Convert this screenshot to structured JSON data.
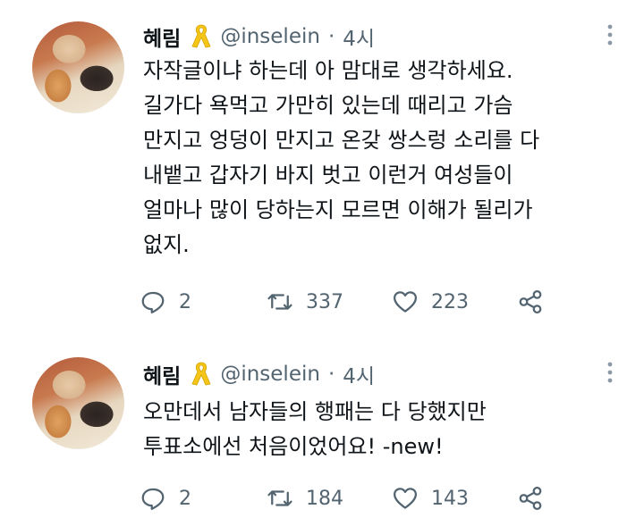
{
  "tweets": [
    {
      "name": "혜림",
      "handle": "@inselein",
      "separator": "·",
      "time": "4시",
      "text": "자작글이냐 하는데 아 맘대로 생각하세요.\n길가다 욕먹고 가만히 있는데 때리고 가슴\n만지고 엉덩이 만지고 온갖 쌍스렁 소리를 다\n내뱉고 갑자기 바지 벗고 이런거 여성들이\n얼마나 많이 당하는지 모르면 이해가 될리가\n없지.",
      "replies": "2",
      "retweets": "337",
      "likes": "223"
    },
    {
      "name": "혜림",
      "handle": "@inselein",
      "separator": "·",
      "time": "4시",
      "text": "오만데서 남자들의 행패는 다 당했지만\n투표소에선 처음이었어요! -new!",
      "replies": "2",
      "retweets": "184",
      "likes": "143"
    }
  ],
  "icons": [
    "yellow-ribbon-icon",
    "more-vertical-icon",
    "reply-icon",
    "retweet-icon",
    "like-icon",
    "share-icon"
  ],
  "colors": {
    "text": "#0f1419",
    "secondary": "#536471",
    "ribbon": "#f5c518"
  }
}
